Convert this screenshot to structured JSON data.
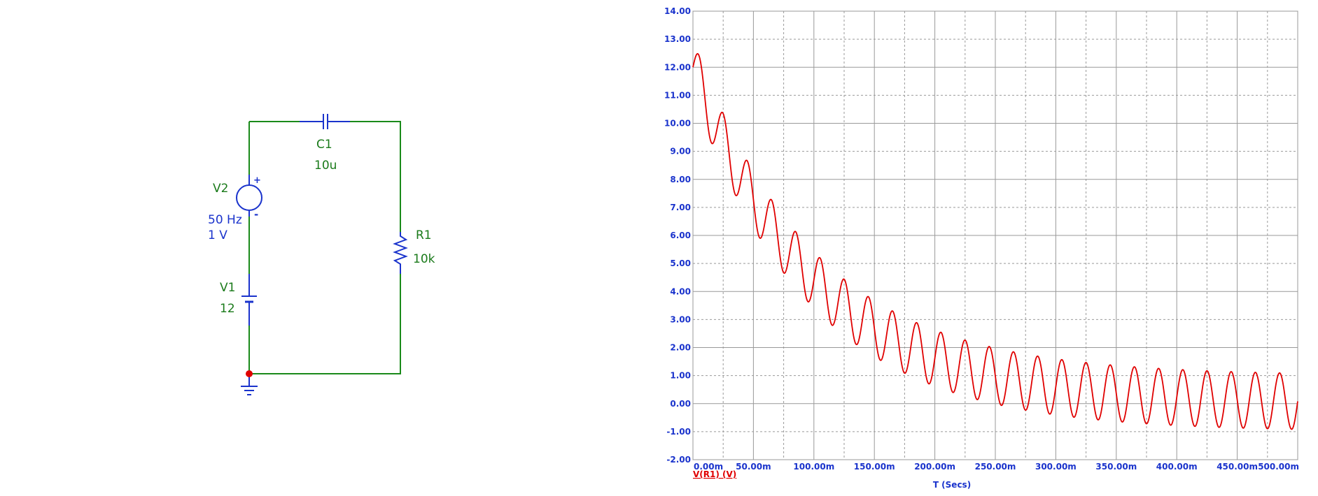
{
  "schematic": {
    "v2": {
      "name": "V2",
      "frequency": "50 Hz",
      "amplitude": "1 V",
      "plus": "+",
      "minus": "-"
    },
    "v1": {
      "name": "V1",
      "value": "12"
    },
    "c1": {
      "name": "C1",
      "value": "10u"
    },
    "r1": {
      "name": "R1",
      "value": "10k"
    },
    "colors": {
      "wire": "#1a8a1a",
      "component": "#1a33cc",
      "node": "#e00000"
    }
  },
  "chart_data": {
    "type": "line",
    "xlabel": "T (Secs)",
    "ylabel": "",
    "xlim": [
      0,
      500
    ],
    "ylim": [
      -2,
      14
    ],
    "x_unit": "m",
    "x_ticks": [
      "0.00m",
      "50.00m",
      "100.00m",
      "150.00m",
      "200.00m",
      "250.00m",
      "300.00m",
      "350.00m",
      "400.00m",
      "450.00m",
      "500.00m"
    ],
    "y_ticks": [
      "14.00",
      "13.00",
      "12.00",
      "11.00",
      "10.00",
      "9.00",
      "8.00",
      "7.00",
      "6.00",
      "5.00",
      "4.00",
      "3.00",
      "2.00",
      "1.00",
      "0.00",
      "-1.00",
      "-2.00"
    ],
    "grid": true,
    "series": [
      {
        "name": "V(R1) (V)",
        "color": "#e00000",
        "model": {
          "dc_start": 12,
          "tau_ms": 100,
          "ac_amplitude": 1,
          "frequency_hz": 50
        }
      }
    ]
  }
}
